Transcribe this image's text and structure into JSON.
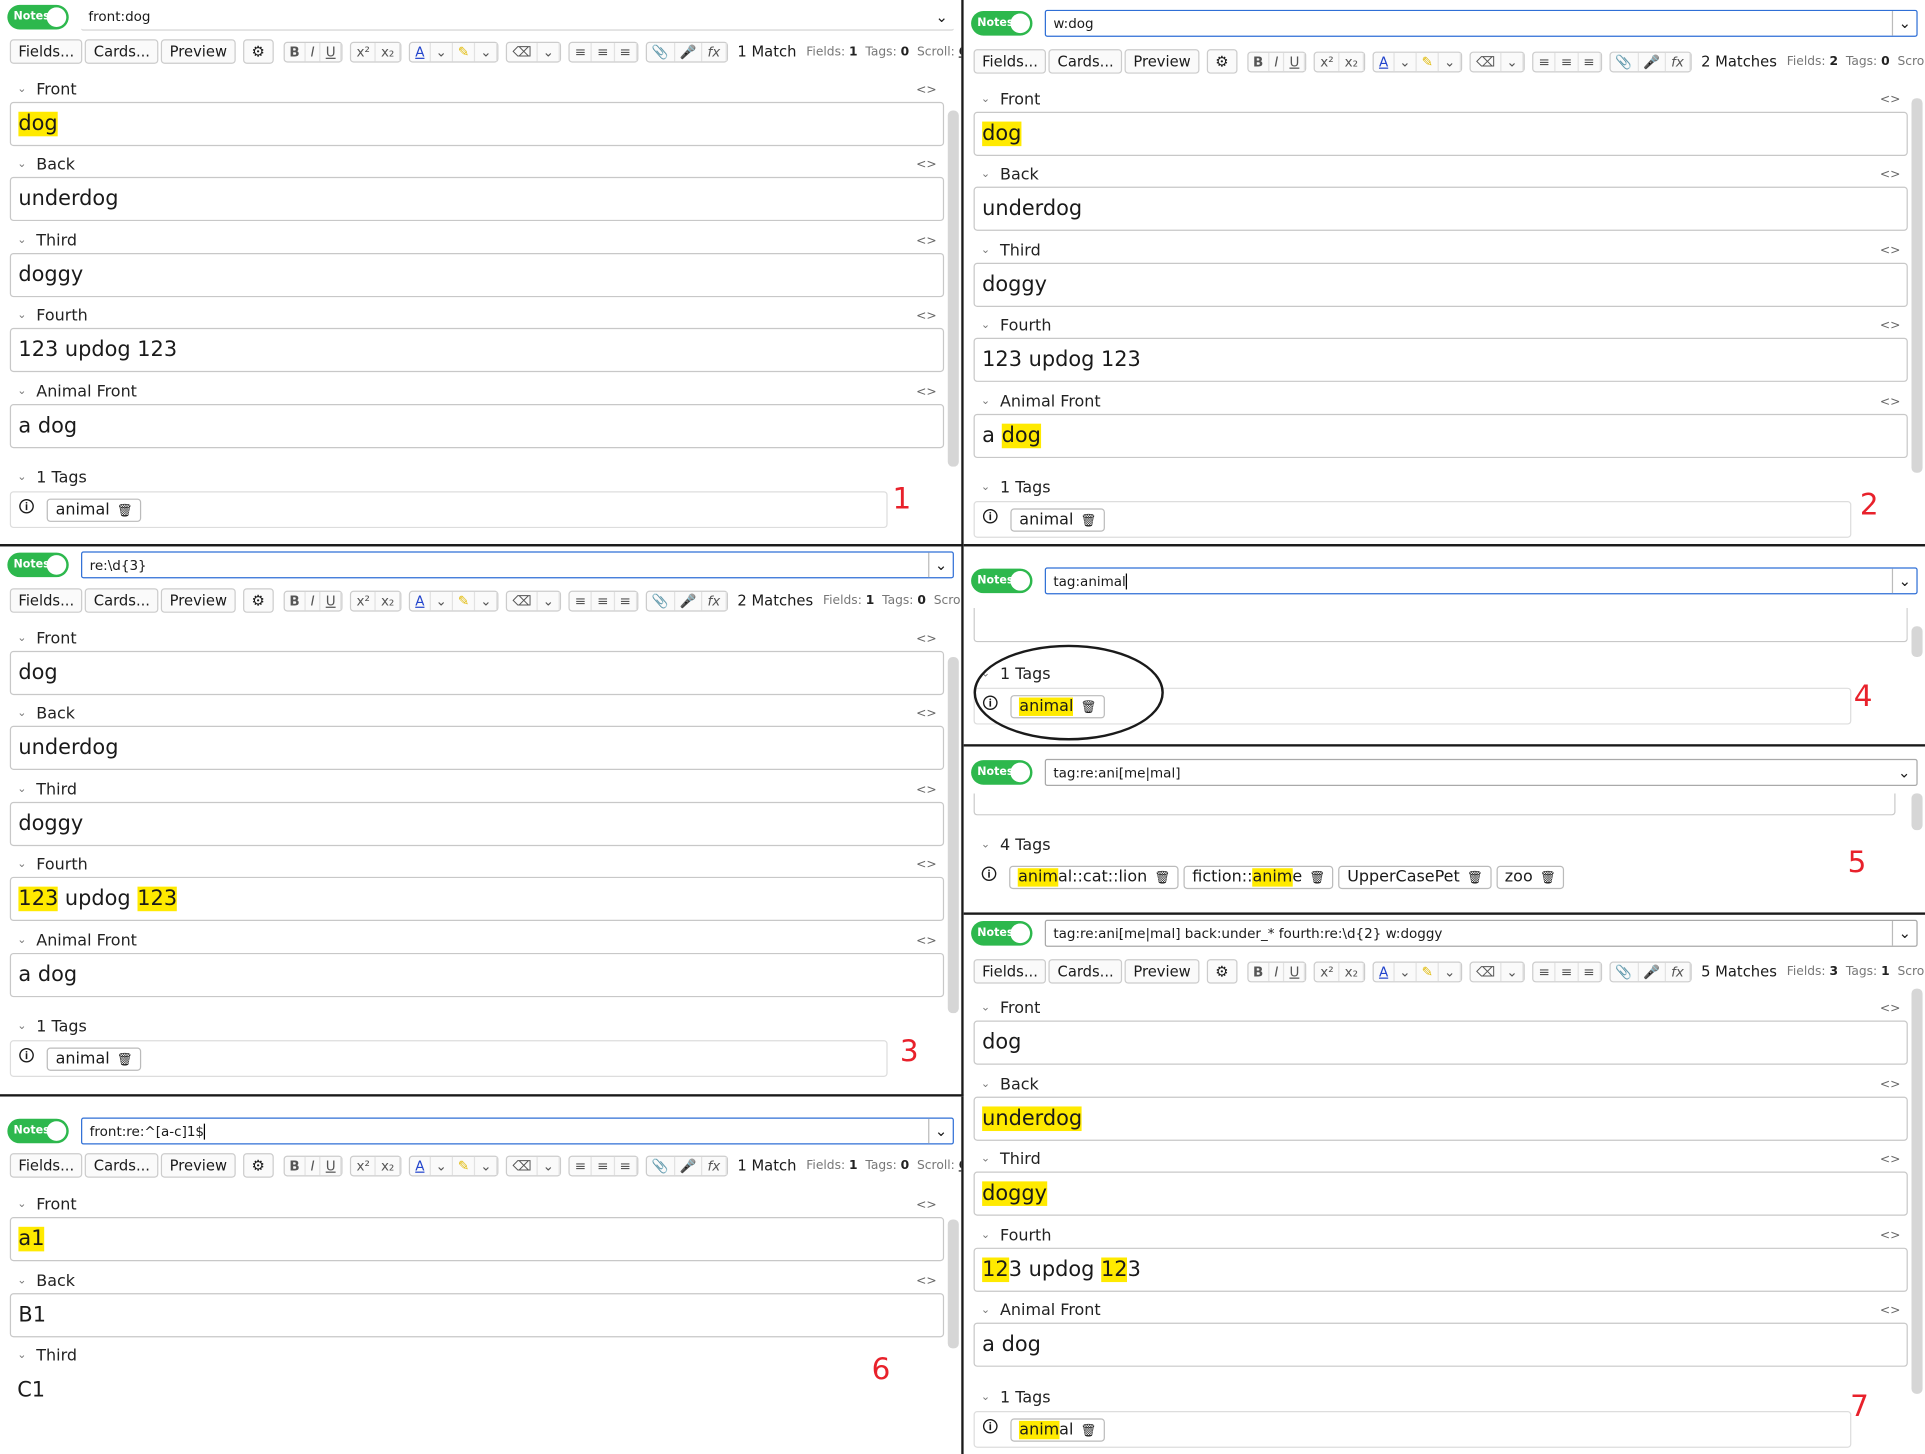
{
  "common": {
    "notes_toggle": "Notes",
    "fields_btn": "Fields...",
    "cards_btn": "Cards...",
    "preview_btn": "Preview",
    "fields_label": "Fields:",
    "tags_label": "Tags:",
    "scroll_label": "Scroll:",
    "scroll_value": "On",
    "tag_animal": "animal",
    "tags_1": "1 Tags",
    "tags_4": "4 Tags",
    "icons": {
      "settings": "gear-icon",
      "bold": "B",
      "italic": "I",
      "underline": "U",
      "superscript": "x²",
      "subscript": "x₂",
      "font_color": "A",
      "highlight": "highlighter-icon",
      "eraser": "eraser-icon",
      "bullet_list": "bullet-list-icon",
      "numbered_list": "numbered-list-icon",
      "align": "align-icon",
      "attach": "paperclip-icon",
      "record": "microphone-icon",
      "math": "fx-icon",
      "collapse": "chevron-down-icon",
      "html_toggle": "code-icon",
      "tag": "tag-icon",
      "delete_tag": "trash-icon",
      "dropdown": "chevron-down-icon"
    },
    "colors": {
      "toggle_on": "#2db84d",
      "highlight": "#ffea00",
      "caption": "#e8212b",
      "focus": "#2f6fd6"
    }
  },
  "p1": {
    "caption": "1",
    "query": "front:dog",
    "matches": "1 Match",
    "fields_count": "1",
    "tags_count": "0",
    "fields": [
      {
        "label": "Front"
      },
      {
        "label": "Back",
        "value": "underdog"
      },
      {
        "label": "Third",
        "value": "doggy"
      },
      {
        "label": "Fourth",
        "value": "123 updog 123"
      },
      {
        "label": "Animal Front",
        "value": "a dog"
      }
    ],
    "front_hl": "dog"
  },
  "p2": {
    "caption": "2",
    "query": "w:dog",
    "matches": "2 Matches",
    "fields_count": "2",
    "tags_count": "0",
    "fields": [
      {
        "label": "Front"
      },
      {
        "label": "Back",
        "value": "underdog"
      },
      {
        "label": "Third",
        "value": "doggy"
      },
      {
        "label": "Fourth",
        "value": "123 updog 123"
      },
      {
        "label": "Animal Front"
      }
    ],
    "front_hl": "dog",
    "animal_pre": "a ",
    "animal_hl": "dog"
  },
  "p3": {
    "caption": "3",
    "query": "re:\\d{3}",
    "matches": "2 Matches",
    "fields_count": "1",
    "tags_count": "0",
    "fields": [
      {
        "label": "Front",
        "value": "dog"
      },
      {
        "label": "Back",
        "value": "underdog"
      },
      {
        "label": "Third",
        "value": "doggy"
      },
      {
        "label": "Fourth"
      },
      {
        "label": "Animal Front",
        "value": "a dog"
      }
    ],
    "fourth_hl1": "123",
    "fourth_mid": " updog ",
    "fourth_hl2": "123"
  },
  "p4": {
    "caption": "4",
    "query": "tag:animal"
  },
  "p5": {
    "caption": "5",
    "query": "tag:re:ani[me|mal]",
    "tags": [
      {
        "hl": "anim",
        "rest": "al::cat::lion"
      },
      {
        "pre": "fiction::",
        "hl": "anim",
        "rest": "e"
      },
      {
        "text": "UpperCasePet"
      },
      {
        "text": "zoo"
      }
    ]
  },
  "p6": {
    "caption": "6",
    "query": "front:re:^[a-c]1$",
    "matches": "1 Match",
    "fields_count": "1",
    "tags_count": "0",
    "fields": [
      {
        "label": "Front",
        "value": "a1"
      },
      {
        "label": "Back",
        "value": "B1"
      },
      {
        "label": "Third",
        "value": "C1"
      }
    ]
  },
  "p7": {
    "caption": "7",
    "query": "tag:re:ani[me|mal] back:under_* fourth:re:\\d{2} w:doggy",
    "matches": "5 Matches",
    "fields_count": "3",
    "tags_count": "1",
    "fields": [
      {
        "label": "Front",
        "value": "dog"
      },
      {
        "label": "Back",
        "value": "underdog"
      },
      {
        "label": "Third",
        "value": "doggy"
      },
      {
        "label": "Fourth"
      },
      {
        "label": "Animal Front",
        "value": "a dog"
      }
    ],
    "fourth_hl1": "12",
    "fourth_mid1": "3 updog ",
    "fourth_hl2": "12",
    "fourth_mid2": "3",
    "tag_hl": "anim",
    "tag_rest": "al"
  }
}
